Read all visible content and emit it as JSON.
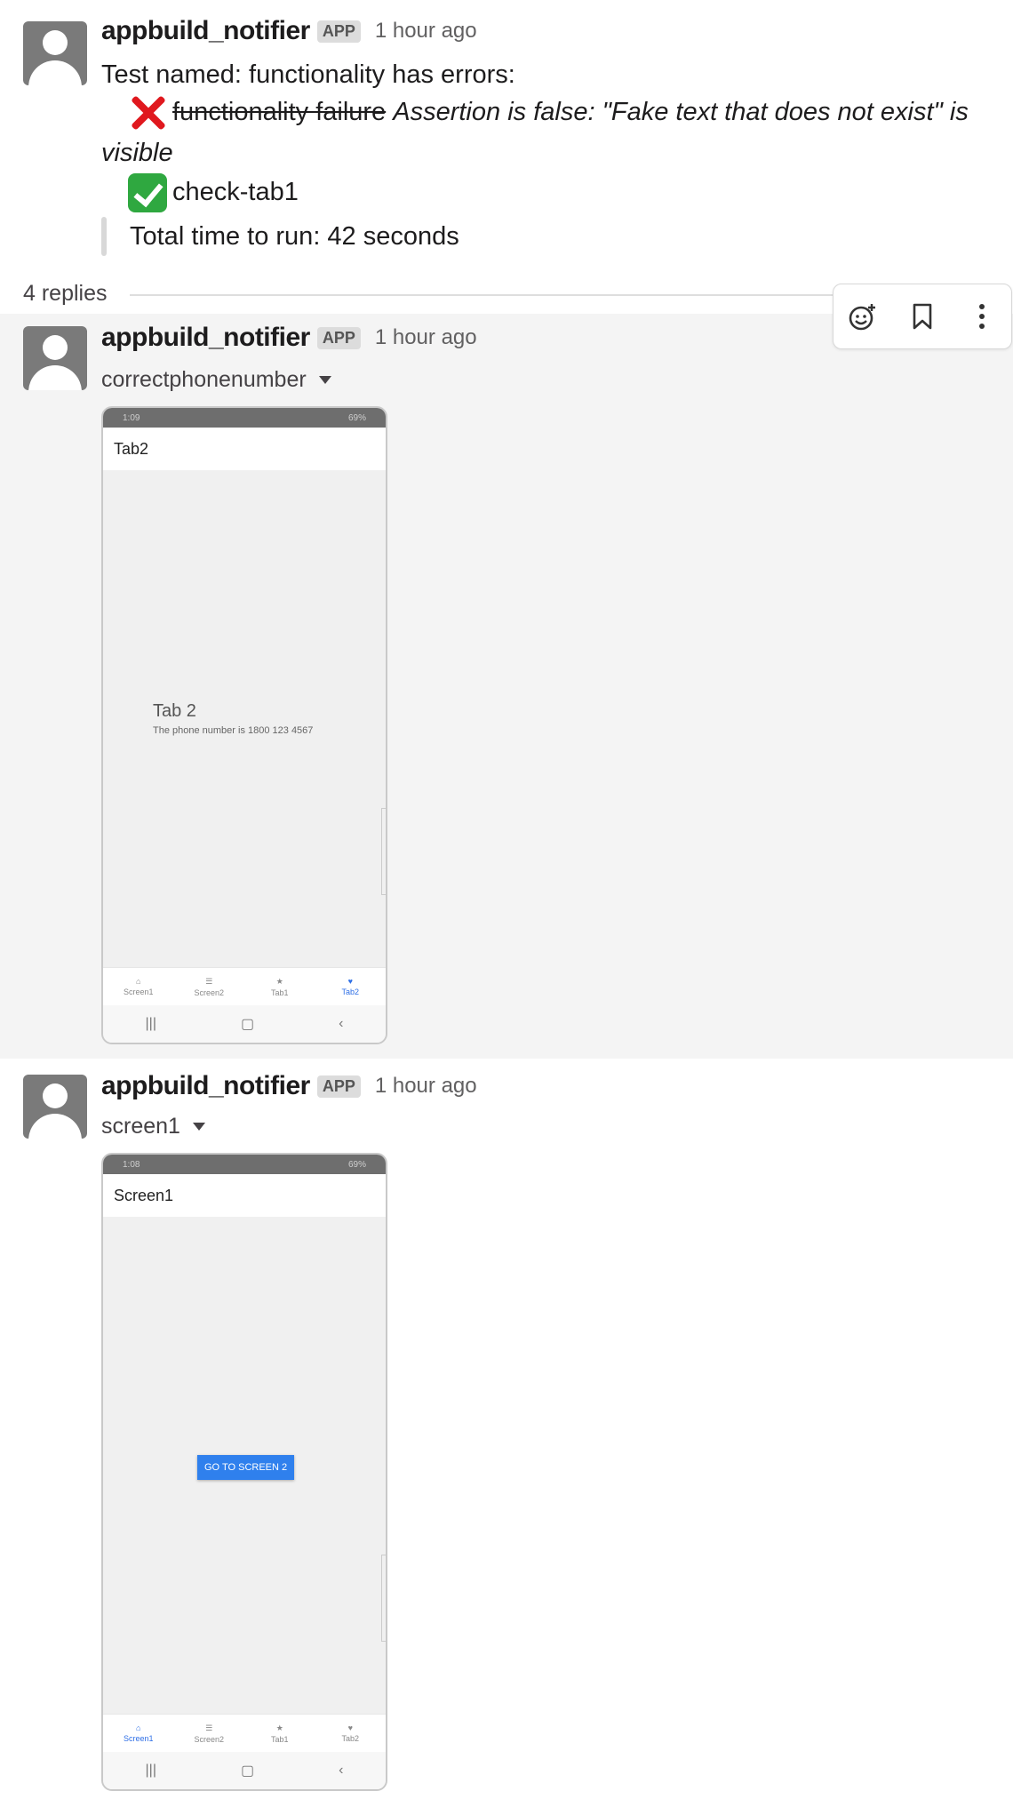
{
  "messages": [
    {
      "sender": "appbuild_notifier",
      "badge": "APP",
      "time": "1 hour ago",
      "title_line": "Test named: functionality has errors:",
      "failure_name": "functionality failure",
      "failure_detail_1": "Assertion is false: \"Fake text that does not exist\" is",
      "failure_detail_2": "visible",
      "pass_name": "check-tab1",
      "total_time": "Total time to run: 42 seconds"
    },
    {
      "sender": "appbuild_notifier",
      "badge": "APP",
      "time": "1 hour ago",
      "file_name": "correctphonenumber",
      "screenshot": {
        "status_time": "1:09",
        "status_right": "69%",
        "title": "Tab2",
        "heading": "Tab 2",
        "body_text": "The phone number is 1800 123 4567",
        "tabs": [
          "Screen1",
          "Screen2",
          "Tab1",
          "Tab2"
        ],
        "active_tab": "Tab2"
      }
    },
    {
      "sender": "appbuild_notifier",
      "badge": "APP",
      "time": "1 hour ago",
      "file_name": "screen1",
      "screenshot": {
        "status_time": "1:08",
        "status_right": "69%",
        "title": "Screen1",
        "button_label": "GO TO SCREEN 2",
        "tabs": [
          "Screen1",
          "Screen2",
          "Tab1",
          "Tab2"
        ],
        "active_tab": "Screen1"
      }
    }
  ],
  "thread": {
    "replies_label": "4 replies"
  },
  "colors": {
    "accent": "#2f6fe6",
    "error": "#e0181e",
    "success": "#2fa840"
  }
}
